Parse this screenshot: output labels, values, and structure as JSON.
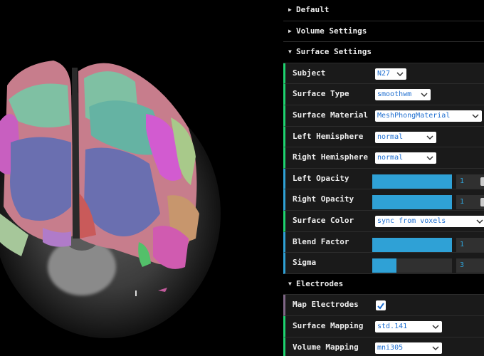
{
  "panel": {
    "folders": {
      "default": {
        "label": "Default",
        "open": false
      },
      "volume_settings": {
        "label": "Volume Settings",
        "open": false
      },
      "surface_settings": {
        "label": "Surface Settings",
        "open": true
      },
      "electrodes": {
        "label": "Electrodes",
        "open": true
      }
    },
    "surface": {
      "subject": {
        "label": "Subject",
        "value": "N27"
      },
      "surface_type": {
        "label": "Surface Type",
        "value": "smoothwm"
      },
      "surface_material": {
        "label": "Surface Material",
        "value": "MeshPhongMaterial"
      },
      "left_hemisphere": {
        "label": "Left Hemisphere",
        "value": "normal"
      },
      "right_hemisphere": {
        "label": "Right Hemisphere",
        "value": "normal"
      },
      "left_opacity": {
        "label": "Left Opacity",
        "value": "1",
        "fill": 1.0
      },
      "right_opacity": {
        "label": "Right Opacity",
        "value": "1",
        "fill": 1.0
      },
      "surface_color": {
        "label": "Surface Color",
        "value": "sync from voxels"
      },
      "blend_factor": {
        "label": "Blend Factor",
        "value": "1",
        "fill": 1.0
      },
      "sigma": {
        "label": "Sigma",
        "value": "3",
        "fill": 0.3
      }
    },
    "electrodes": {
      "map_electrodes": {
        "label": "Map Electrodes",
        "checked": true
      },
      "surface_mapping": {
        "label": "Surface Mapping",
        "value": "std.141"
      },
      "volume_mapping": {
        "label": "Volume Mapping",
        "value": "mni305"
      }
    }
  },
  "colors": {
    "number_accent": "#2fa1d6",
    "select_accent": "#1ed36f",
    "bool_accent": "#806787",
    "select_text": "#1f6fd0"
  },
  "icons": {
    "collapsed": "triangle-right-icon",
    "expanded": "triangle-down-icon",
    "dropdown": "chevron-down-icon",
    "check": "checkmark-icon"
  }
}
